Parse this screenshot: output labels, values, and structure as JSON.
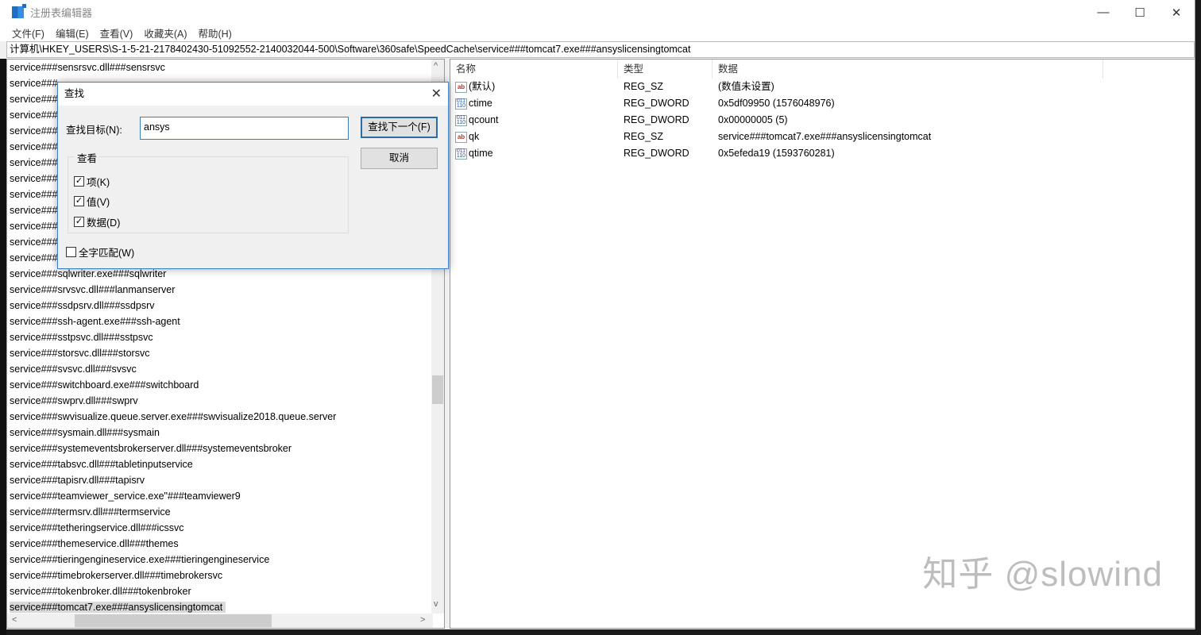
{
  "window": {
    "title": "注册表编辑器",
    "minimize": "—",
    "maximize": "☐",
    "close": "✕"
  },
  "menu": [
    "文件(F)",
    "编辑(E)",
    "查看(V)",
    "收藏夹(A)",
    "帮助(H)"
  ],
  "address": "计算机\\HKEY_USERS\\S-1-5-21-2178402430-51092552-2140032044-500\\Software\\360safe\\SpeedCache\\service###tomcat7.exe###ansyslicensingtomcat",
  "tree": [
    "service###sensrsvc.dll###sensrsvc",
    "service###",
    "service###",
    "service###",
    "service###",
    "service###",
    "service###",
    "service###",
    "service###",
    "service###",
    "service###",
    "service###",
    "service###",
    "service###sqlwriter.exe###sqlwriter",
    "service###srvsvc.dll###lanmanserver",
    "service###ssdpsrv.dll###ssdpsrv",
    "service###ssh-agent.exe###ssh-agent",
    "service###sstpsvc.dll###sstpsvc",
    "service###storsvc.dll###storsvc",
    "service###svsvc.dll###svsvc",
    "service###switchboard.exe###switchboard",
    "service###swprv.dll###swprv",
    "service###swvisualize.queue.server.exe###swvisualize2018.queue.server",
    "service###sysmain.dll###sysmain",
    "service###systemeventsbrokerserver.dll###systemeventsbroker",
    "service###tabsvc.dll###tabletinputservice",
    "service###tapisrv.dll###tapisrv",
    "service###teamviewer_service.exe\"###teamviewer9",
    "service###termsrv.dll###termservice",
    "service###tetheringservice.dll###icssvc",
    "service###themeservice.dll###themes",
    "service###tieringengineservice.exe###tieringengineservice",
    "service###timebrokerserver.dll###timebrokersvc",
    "service###tokenbroker.dll###tokenbroker",
    "service###tomcat7.exe###ansyslicensingtomcat"
  ],
  "values": {
    "headers": [
      "名称",
      "类型",
      "数据"
    ],
    "rows": [
      {
        "icon": "string",
        "name": "(默认)",
        "type": "REG_SZ",
        "data": "(数值未设置)"
      },
      {
        "icon": "dword",
        "name": "ctime",
        "type": "REG_DWORD",
        "data": "0x5df09950 (1576048976)"
      },
      {
        "icon": "dword",
        "name": "qcount",
        "type": "REG_DWORD",
        "data": "0x00000005 (5)"
      },
      {
        "icon": "string",
        "name": "qk",
        "type": "REG_SZ",
        "data": "service###tomcat7.exe###ansyslicensingtomcat"
      },
      {
        "icon": "dword",
        "name": "qtime",
        "type": "REG_DWORD",
        "data": "0x5efeda19 (1593760281)"
      }
    ]
  },
  "find_dialog": {
    "title": "查找",
    "close": "✕",
    "target_label": "查找目标(N):",
    "target_value": "ansys",
    "find_next": "查找下一个(F)",
    "cancel": "取消",
    "group_label": "查看",
    "keys": "项(K)",
    "values": "值(V)",
    "data": "数据(D)",
    "whole_word": "全字匹配(W)",
    "keys_checked": true,
    "values_checked": true,
    "data_checked": true,
    "whole_word_checked": false
  },
  "watermark": "知乎 @slowind",
  "icons": {
    "string": "ab",
    "dword": "011 110"
  }
}
